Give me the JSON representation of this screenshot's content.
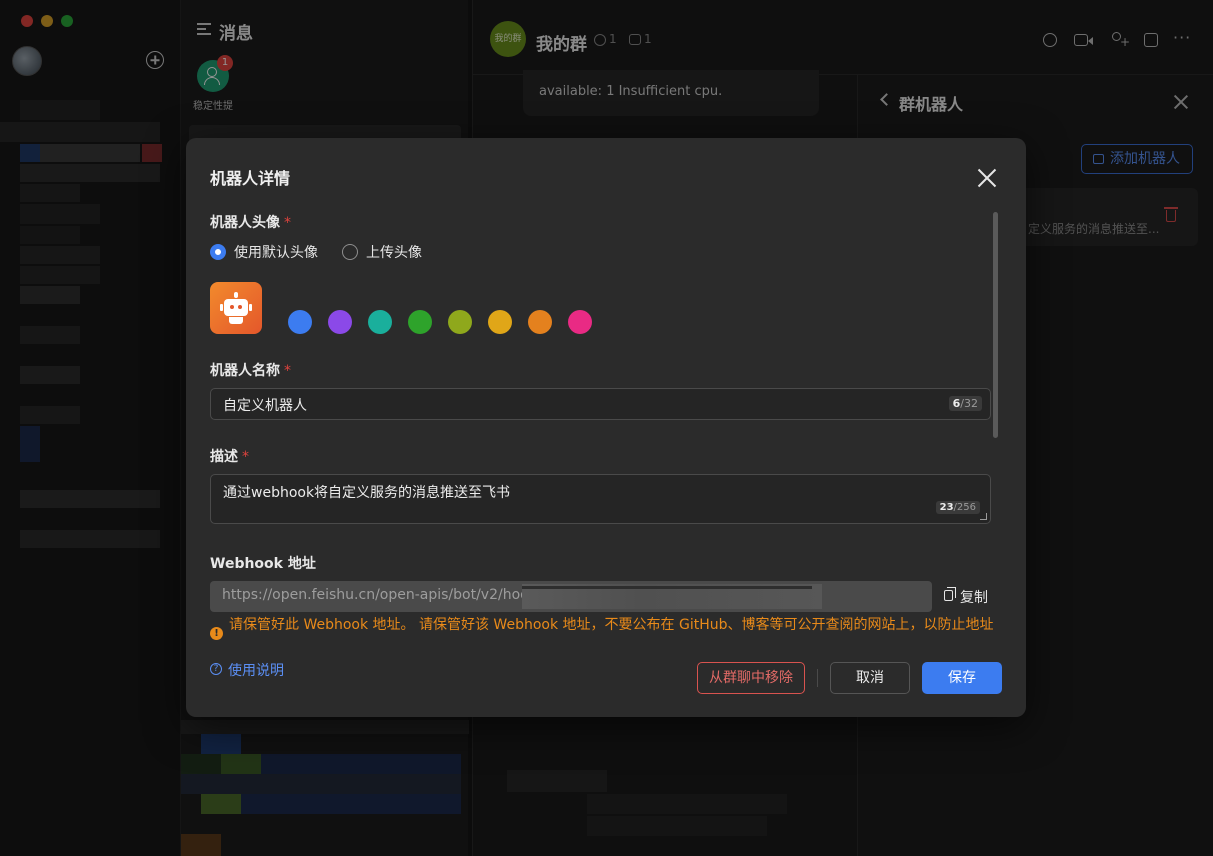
{
  "sidebar": {
    "title": "消息",
    "shortcut": {
      "label": "稳定性提",
      "badge": "1"
    }
  },
  "chat": {
    "group_avatar_text": "我的群",
    "group_name": "我的群",
    "member_count": "1",
    "bot_count": "1",
    "message_text": "available: 1 Insufficient cpu."
  },
  "bot_panel": {
    "title": "群机器人",
    "add_bot_label": "添加机器人",
    "card_desc": "定义服务的消息推送至..."
  },
  "dialog": {
    "title": "机器人详情",
    "avatar_label": "机器人头像",
    "required_mark": "*",
    "avatar_options": [
      {
        "label": "使用默认头像",
        "selected": true
      },
      {
        "label": "上传头像",
        "selected": false
      }
    ],
    "avatar_colors": [
      "#3c7cf0",
      "#8b49e8",
      "#1aaf9c",
      "#2ea32b",
      "#8fa81c",
      "#e0a618",
      "#e4811e",
      "#e92a84"
    ],
    "name_label": "机器人名称",
    "name_value": "自定义机器人",
    "name_count": "6",
    "name_max": "/32",
    "desc_label": "描述",
    "desc_value": "通过webhook将自定义服务的消息推送至飞书",
    "desc_count": "23",
    "desc_max": "/256",
    "webhook_label": "Webhook 地址",
    "webhook_value": "https://open.feishu.cn/open-apis/bot/v2/hook/",
    "copy_label": "复制",
    "warning_icon": "!",
    "warning_text": "请保管好此 Webhook 地址。 请保管好该 Webhook 地址，不要公布在 GitHub、博客等可公开查阅的网站上，以防止地址",
    "help_label": "使用说明",
    "help_icon": "?",
    "remove_label": "从群聊中移除",
    "cancel_label": "取消",
    "save_label": "保存"
  }
}
